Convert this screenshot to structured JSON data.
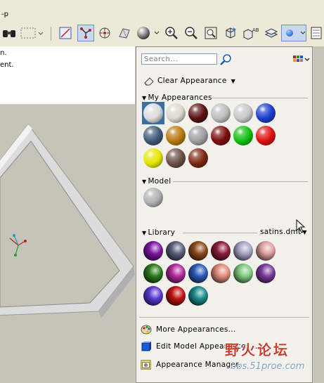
{
  "window": {
    "breadcrumb": "-p"
  },
  "left_panel": {
    "lines": [
      "n.",
      "ent."
    ]
  },
  "toolbar": {
    "icons": [
      "binoculars-icon",
      "select-box-icon",
      "sketch-icon",
      "datum-point-icon",
      "spin-center-icon",
      "repaint-icon",
      "appearance-sphere-icon",
      "zoom-in-icon",
      "zoom-out-icon",
      "refit-icon",
      "orient-icon",
      "named-view-icon",
      "layers-icon",
      "appearance-gallery-icon",
      "model-tree-icon"
    ]
  },
  "appearance_gallery": {
    "search": {
      "placeholder": "Search..."
    },
    "clear_label": "Clear Appearance",
    "my_appearances": {
      "title": "My Appearances",
      "swatches": [
        {
          "name": "white-silver",
          "color": "#dcdcdc",
          "selected": true
        },
        {
          "name": "pearl",
          "color": "#d8d8cc",
          "selected": false
        },
        {
          "name": "dark-red",
          "color": "#5a1010",
          "selected": false
        },
        {
          "name": "grey-split",
          "color": "#bdbdbd",
          "selected": false
        },
        {
          "name": "silver",
          "color": "#c8c8c8",
          "selected": false
        },
        {
          "name": "blue",
          "color": "#1a3fd0",
          "selected": false
        },
        {
          "name": "steel-blue",
          "color": "#3e5a7a",
          "selected": false
        },
        {
          "name": "gold",
          "color": "#b87a10",
          "selected": false
        },
        {
          "name": "grey",
          "color": "#a0a0a0",
          "selected": false
        },
        {
          "name": "maroon",
          "color": "#7a0c0c",
          "selected": false
        },
        {
          "name": "green",
          "color": "#10c010",
          "selected": false
        },
        {
          "name": "red",
          "color": "#e01010",
          "selected": false
        },
        {
          "name": "yellow",
          "color": "#e6e600",
          "selected": false
        },
        {
          "name": "stone",
          "color": "#6a5048",
          "selected": false
        },
        {
          "name": "brick",
          "color": "#7a2812",
          "selected": false
        }
      ]
    },
    "model": {
      "title": "Model",
      "swatches": [
        {
          "name": "model-grey",
          "color": "#b0b0b0",
          "selected": false
        }
      ]
    },
    "library": {
      "title": "Library",
      "file": "satins.dmt",
      "swatches": [
        {
          "name": "satin-purple",
          "color": "#7a16a0"
        },
        {
          "name": "satin-slate",
          "color": "#5a5f7a"
        },
        {
          "name": "satin-brown",
          "color": "#8a4a1a"
        },
        {
          "name": "satin-wine",
          "color": "#8a1a3a"
        },
        {
          "name": "satin-lavender",
          "color": "#a8a4c8"
        },
        {
          "name": "satin-rose",
          "color": "#e0a0a0"
        },
        {
          "name": "satin-green",
          "color": "#2a7a1a"
        },
        {
          "name": "satin-magenta",
          "color": "#b02a9a"
        },
        {
          "name": "satin-blue",
          "color": "#2a5ab8"
        },
        {
          "name": "satin-salmon",
          "color": "#e08a7a"
        },
        {
          "name": "satin-mint",
          "color": "#80c880"
        },
        {
          "name": "satin-violet",
          "color": "#7a3a9a"
        },
        {
          "name": "satin-indigo",
          "color": "#5a3ad0"
        },
        {
          "name": "satin-red",
          "color": "#c01010"
        },
        {
          "name": "satin-teal",
          "color": "#1a8a8a"
        }
      ]
    },
    "actions": [
      {
        "label": "More Appearances...",
        "icon": "palette-icon"
      },
      {
        "label": "Edit Model Appearances...",
        "icon": "cube-icon"
      },
      {
        "label": "Appearance Manager...",
        "icon": "manager-icon"
      }
    ]
  },
  "watermark": {
    "brand": "野火论坛",
    "url": "bbs.51proe.com"
  }
}
